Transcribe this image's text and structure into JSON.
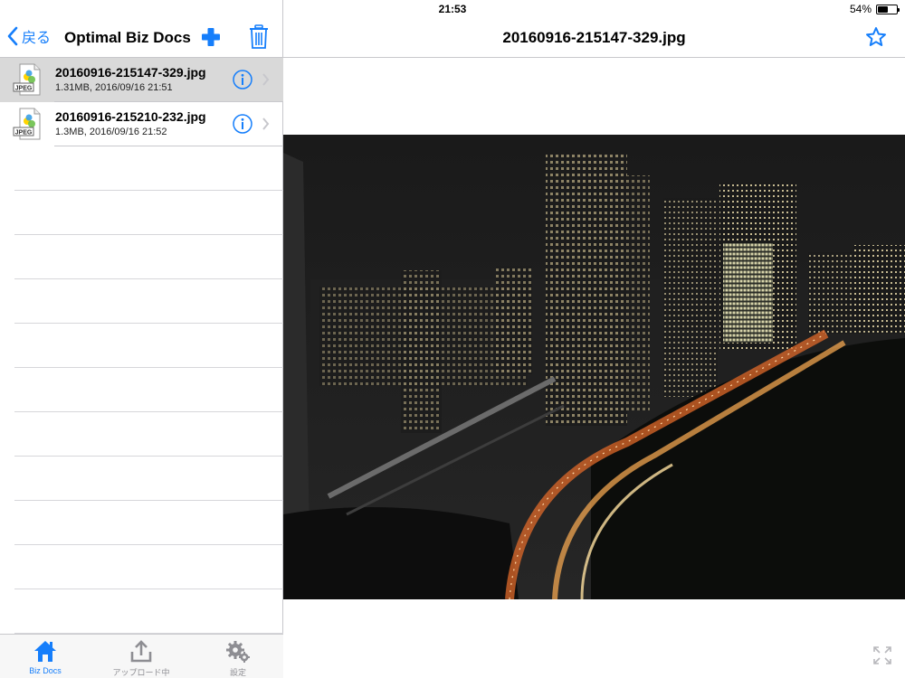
{
  "statusbar": {
    "device": "iPad",
    "time": "21:53",
    "battery": "54%",
    "battery_level": 0.54
  },
  "left_nav": {
    "back_label": "戻る",
    "title": "Optimal Biz Docs"
  },
  "files": [
    {
      "name": "20160916-215147-329.jpg",
      "meta": "1.31MB, 2016/09/16 21:51",
      "icon_label": "JPEG",
      "selected": true
    },
    {
      "name": "20160916-215210-232.jpg",
      "meta": "1.3MB, 2016/09/16 21:52",
      "icon_label": "JPEG",
      "selected": false
    }
  ],
  "tabbar": {
    "items": [
      {
        "label": "Biz Docs",
        "icon": "home-icon",
        "active": true
      },
      {
        "label": "アップロード中",
        "icon": "upload-icon",
        "active": false
      },
      {
        "label": "設定",
        "icon": "gear-icon",
        "active": false
      }
    ]
  },
  "viewer": {
    "title": "20160916-215147-329.jpg"
  },
  "colors": {
    "accent": "#157efb",
    "selected_row": "#d9d9d9",
    "separator": "#c8c8cc",
    "inactive_tab": "#8e8e93"
  }
}
